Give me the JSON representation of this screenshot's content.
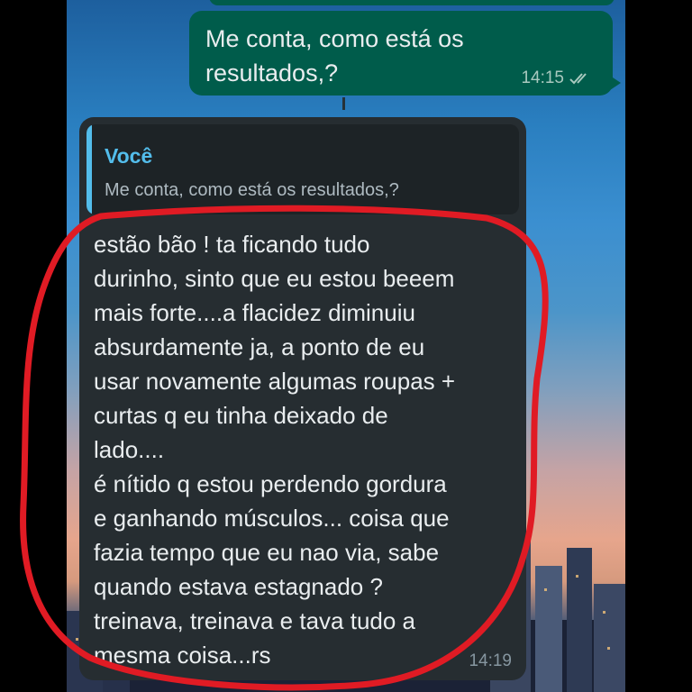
{
  "outgoing": {
    "lines": [
      "Me conta, como está os",
      "resultados,?"
    ],
    "time": "14:15",
    "status_icon": "double-check-icon"
  },
  "incoming": {
    "quote": {
      "author": "Você",
      "text": "Me conta, como está os resultados,?"
    },
    "lines": [
      "estão bão !  ta ficando tudo",
      "durinho, sinto que eu estou beeem",
      "mais forte....a flacidez diminuiu",
      "absurdamente ja, a ponto de eu",
      "usar novamente algumas roupas +",
      "curtas q eu tinha deixado de",
      "lado....",
      "é nítido q estou perdendo gordura",
      "e ganhando músculos... coisa que",
      "fazia tempo que eu nao via, sabe",
      "quando estava estagnado ?",
      "treinava, treinava e tava tudo a",
      "mesma coisa...rs"
    ],
    "time": "14:19"
  },
  "colors": {
    "outgoing_bubble": "#005c4b",
    "incoming_bubble": "#262d31",
    "quote_accent": "#53bdeb",
    "annotation": "#e01b24"
  }
}
